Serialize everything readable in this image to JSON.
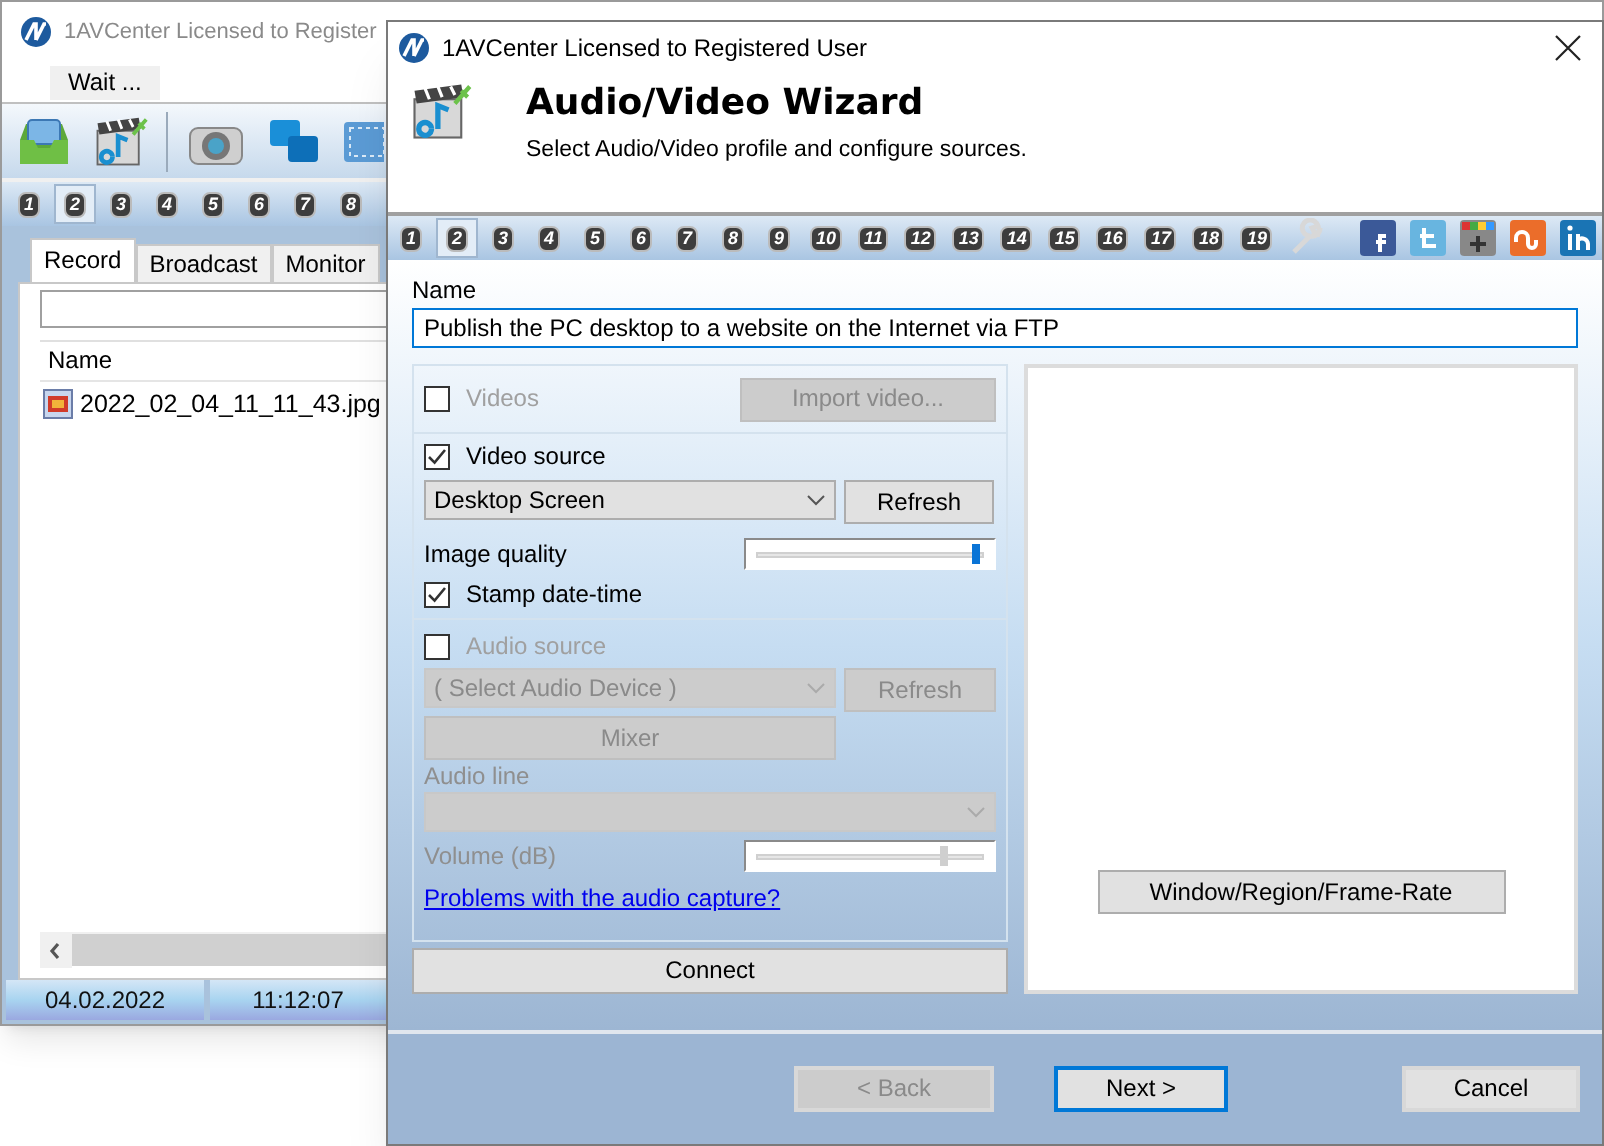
{
  "main_window": {
    "title": "1AVCenter Licensed to Register",
    "menu": [
      "Wait ..."
    ],
    "profiles": [
      {
        "label": "1",
        "selected": false
      },
      {
        "label": "2",
        "selected": true
      },
      {
        "label": "3",
        "selected": false
      },
      {
        "label": "4",
        "selected": false
      },
      {
        "label": "5",
        "selected": false
      },
      {
        "label": "6",
        "selected": false
      },
      {
        "label": "7",
        "selected": false
      },
      {
        "label": "8",
        "selected": false
      }
    ],
    "tabs": [
      {
        "label": "Record",
        "selected": true
      },
      {
        "label": "Broadcast",
        "selected": false
      },
      {
        "label": "Monitor",
        "selected": false
      }
    ],
    "list": {
      "columns": [
        "Name"
      ],
      "rows": [
        "2022_02_04_11_11_43.jpg"
      ]
    },
    "status_bar": [
      "04.02.2022",
      "11:12:07"
    ]
  },
  "dialog": {
    "title": "1AVCenter Licensed to Registered User",
    "heading": "Audio/Video Wizard",
    "subtitle": "Select Audio/Video profile and configure sources.",
    "profiles": [
      {
        "label": "1",
        "selected": false
      },
      {
        "label": "2",
        "selected": true
      },
      {
        "label": "3",
        "selected": false
      },
      {
        "label": "4",
        "selected": false
      },
      {
        "label": "5",
        "selected": false
      },
      {
        "label": "6",
        "selected": false
      },
      {
        "label": "7",
        "selected": false
      },
      {
        "label": "8",
        "selected": false
      },
      {
        "label": "9",
        "selected": false
      },
      {
        "label": "10",
        "selected": false
      },
      {
        "label": "11",
        "selected": false
      },
      {
        "label": "12",
        "selected": false
      },
      {
        "label": "13",
        "selected": false
      },
      {
        "label": "14",
        "selected": false
      },
      {
        "label": "15",
        "selected": false
      },
      {
        "label": "16",
        "selected": false
      },
      {
        "label": "17",
        "selected": false
      },
      {
        "label": "18",
        "selected": false
      },
      {
        "label": "19",
        "selected": false
      }
    ],
    "name": {
      "label": "Name",
      "value": "Publish the PC desktop to a website on the Internet via FTP"
    },
    "videos": {
      "label": "Videos",
      "checked": false,
      "disabled": true,
      "button": "Import video..."
    },
    "video_source": {
      "label": "Video source",
      "checked": true,
      "disabled": false,
      "device": "Desktop Screen",
      "refresh": "Refresh"
    },
    "image_quality": {
      "label": "Image quality",
      "level": 0.97
    },
    "stamp": {
      "label": "Stamp date-time",
      "checked": true,
      "disabled": false
    },
    "audio_source": {
      "label": "Audio source",
      "checked": false,
      "disabled": true,
      "device": "( Select Audio Device )",
      "refresh": "Refresh",
      "mixer": "Mixer",
      "line_label": "Audio line"
    },
    "volume": {
      "label": "Volume (dB)",
      "level": 0.83,
      "disabled": true
    },
    "link": "Problems with the audio capture?",
    "connect": "Connect",
    "region_button": "Window/Region/Frame-Rate",
    "buttons": [
      {
        "label": "< Back",
        "disabled": true,
        "focused": false
      },
      {
        "label": "Next >",
        "disabled": false,
        "focused": true
      },
      {
        "label": "Cancel",
        "disabled": false,
        "focused": false
      }
    ]
  }
}
